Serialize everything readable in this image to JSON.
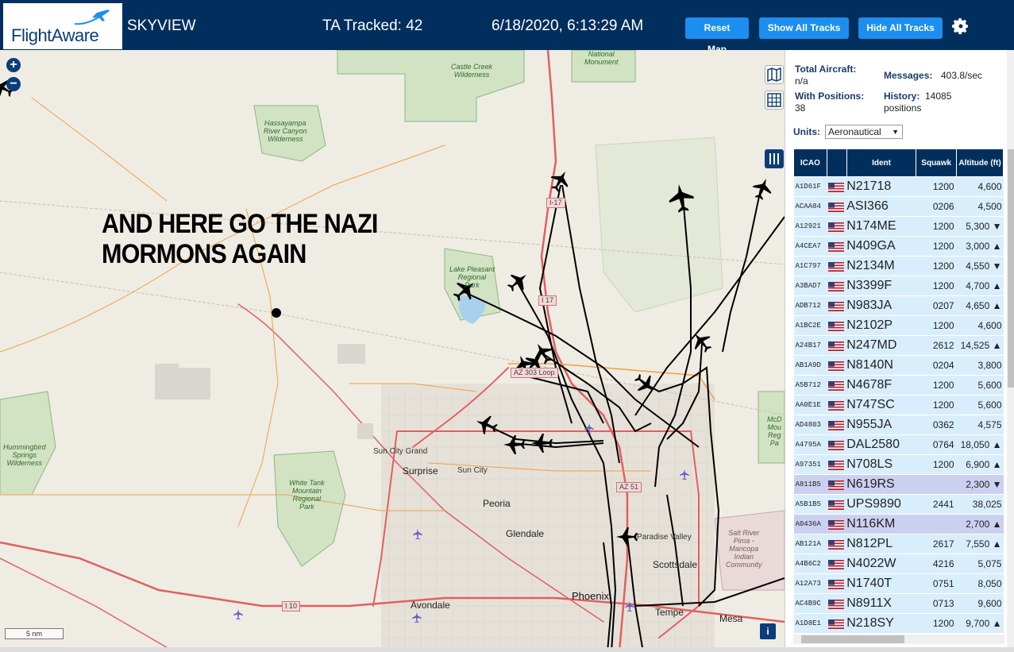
{
  "header": {
    "logo": "FlightAware",
    "app_title": "SKYVIEW",
    "tracked": "TA Tracked: 42",
    "clock": "6/18/2020, 6:13:29 AM",
    "btn_reset": "Reset Map",
    "btn_show": "Show All Tracks",
    "btn_hide": "Hide All Tracks"
  },
  "overlay_text": {
    "line1": "AND HERE GO THE NAZI",
    "line2": "MORMONS AGAIN"
  },
  "map": {
    "zoom_in": "+",
    "zoom_out": "−",
    "scale": "5 nm",
    "info": "i",
    "labels": {
      "castle_creek": "Castle Creek\nWilderness",
      "hassayampa": "Hassayampa\nRiver Canyon\nWilderness",
      "national_monument": "National\nMonument",
      "lake_pleasant": "Lake Pleasant\nRegional\nPark",
      "hummingbird": "Hummingbird\nSprings\nWilderness",
      "white_tank": "White Tank\nMountain\nRegional\nPark",
      "mcdowell": "McD\nMou\nReg\nPa",
      "salt_river": "Salt River\nPima -\nMaricopa\nIndian\nCommunity",
      "sun_city_grand": "Sun City Grand",
      "surprise": "Surprise",
      "sun_city": "Sun City",
      "peoria": "Peoria",
      "glendale": "Glendale",
      "paradise_valley": "Paradise Valley",
      "scottsdale": "Scottsdale",
      "phoenix": "Phoenix",
      "avondale": "Avondale",
      "tempe": "Tempe",
      "mesa": "Mesa"
    },
    "highways": {
      "i17_a": "I-17",
      "i17_b": "I 17",
      "loop303": "AZ 303 Loop",
      "az51": "AZ 51",
      "i10": "I 10"
    }
  },
  "panel": {
    "total_aircraft_label": "Total Aircraft:",
    "total_aircraft_value": "n/a",
    "messages_label": "Messages:",
    "messages_value": "403.8/sec",
    "with_positions_label": "With Positions:",
    "with_positions_value": "38",
    "history_label": "History:",
    "history_value": "14085",
    "history_unit": "positions",
    "units_label": "Units:",
    "units_value": "Aeronautical",
    "columns": [
      "ICAO",
      "",
      "Ident",
      "Squawk",
      "Altitude (ft)"
    ],
    "rows": [
      {
        "icao": "A1D61F",
        "ident": "N21718",
        "squawk": "1200",
        "alt": "4,600",
        "sel": false
      },
      {
        "icao": "ACAA84",
        "ident": "ASI366",
        "squawk": "0206",
        "alt": "4,500",
        "sel": false
      },
      {
        "icao": "A12921",
        "ident": "N174ME",
        "squawk": "1200",
        "alt": "5,300 ▼",
        "sel": false
      },
      {
        "icao": "A4CEA7",
        "ident": "N409GA",
        "squawk": "1200",
        "alt": "3,000 ▲",
        "sel": false
      },
      {
        "icao": "A1C797",
        "ident": "N2134M",
        "squawk": "1200",
        "alt": "4,550 ▼",
        "sel": false
      },
      {
        "icao": "A3BAD7",
        "ident": "N3399F",
        "squawk": "1200",
        "alt": "4,700 ▲",
        "sel": false
      },
      {
        "icao": "ADB712",
        "ident": "N983JA",
        "squawk": "0207",
        "alt": "4,650 ▲",
        "sel": false
      },
      {
        "icao": "A1BC2E",
        "ident": "N2102P",
        "squawk": "1200",
        "alt": "4,600",
        "sel": false
      },
      {
        "icao": "A24B17",
        "ident": "N247MD",
        "squawk": "2612",
        "alt": "14,525 ▲",
        "sel": false
      },
      {
        "icao": "AB1A9D",
        "ident": "N8140N",
        "squawk": "0204",
        "alt": "3,800",
        "sel": false
      },
      {
        "icao": "A5B712",
        "ident": "N4678F",
        "squawk": "1200",
        "alt": "5,600",
        "sel": false
      },
      {
        "icao": "AA0E1E",
        "ident": "N747SC",
        "squawk": "1200",
        "alt": "5,600",
        "sel": false
      },
      {
        "icao": "AD4803",
        "ident": "N955JA",
        "squawk": "0362",
        "alt": "4,575",
        "sel": false
      },
      {
        "icao": "A4795A",
        "ident": "DAL2580",
        "squawk": "0764",
        "alt": "18,050 ▲",
        "sel": false
      },
      {
        "icao": "A97351",
        "ident": "N708LS",
        "squawk": "1200",
        "alt": "6,900 ▲",
        "sel": false
      },
      {
        "icao": "A811B5",
        "ident": "N619RS",
        "squawk": "",
        "alt": "2,300 ▼",
        "sel": true
      },
      {
        "icao": "A5B1B5",
        "ident": "UPS9890",
        "squawk": "2441",
        "alt": "38,025",
        "sel": false
      },
      {
        "icao": "A0436A",
        "ident": "N116KM",
        "squawk": "",
        "alt": "2,700 ▲",
        "sel": true
      },
      {
        "icao": "AB121A",
        "ident": "N812PL",
        "squawk": "2617",
        "alt": "7,550 ▲",
        "sel": false
      },
      {
        "icao": "A4B6C2",
        "ident": "N4022W",
        "squawk": "4216",
        "alt": "5,075",
        "sel": false
      },
      {
        "icao": "A12A73",
        "ident": "N1740T",
        "squawk": "0751",
        "alt": "8,050",
        "sel": false
      },
      {
        "icao": "AC4B9C",
        "ident": "N8911X",
        "squawk": "0713",
        "alt": "9,600",
        "sel": false
      },
      {
        "icao": "A1D8E1",
        "ident": "N218SY",
        "squawk": "1200",
        "alt": "9,700 ▲",
        "sel": false
      }
    ]
  }
}
